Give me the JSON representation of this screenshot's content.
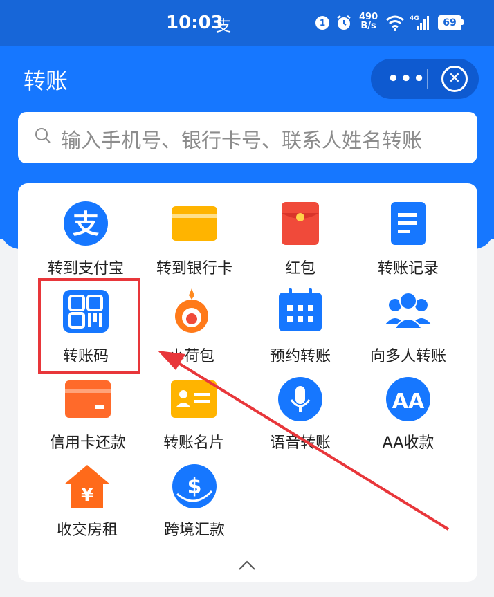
{
  "status_bar": {
    "time": "10:03",
    "carrier_icon": "支",
    "net_speed_value": "490",
    "net_speed_unit": "B/s",
    "battery": "69"
  },
  "header": {
    "title": "转账",
    "more_label": "•••",
    "close_label": "✕"
  },
  "search": {
    "placeholder": "输入手机号、银行卡号、联系人姓名转账"
  },
  "colors": {
    "brand_blue": "#1677ff",
    "highlight_red": "#e8363a"
  },
  "grid": {
    "items": [
      {
        "label": "转到支付宝",
        "icon": "alipay-icon"
      },
      {
        "label": "转到银行卡",
        "icon": "bank-card-icon"
      },
      {
        "label": "红包",
        "icon": "red-envelope-icon"
      },
      {
        "label": "转账记录",
        "icon": "transfer-record-icon"
      },
      {
        "label": "转账码",
        "icon": "qr-code-icon"
      },
      {
        "label": "小荷包",
        "icon": "small-purse-icon"
      },
      {
        "label": "预约转账",
        "icon": "calendar-icon"
      },
      {
        "label": "向多人转账",
        "icon": "multi-user-icon"
      },
      {
        "label": "信用卡还款",
        "icon": "credit-card-icon"
      },
      {
        "label": "转账名片",
        "icon": "business-card-icon"
      },
      {
        "label": "语音转账",
        "icon": "microphone-icon"
      },
      {
        "label": "AA收款",
        "icon": "aa-icon"
      },
      {
        "label": "收交房租",
        "icon": "house-rent-icon"
      },
      {
        "label": "跨境汇款",
        "icon": "cross-border-icon"
      }
    ]
  }
}
